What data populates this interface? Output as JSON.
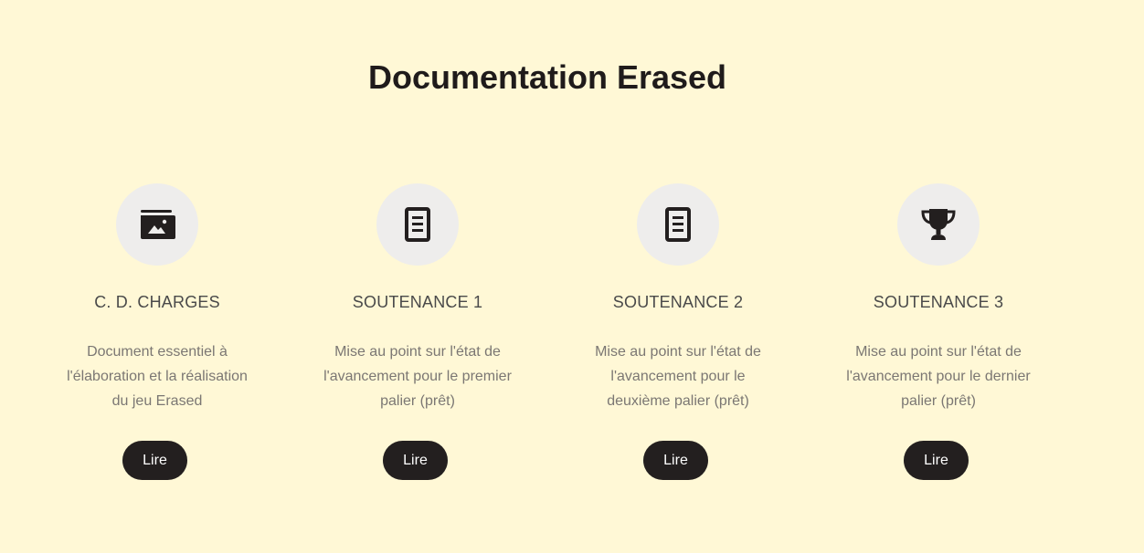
{
  "page": {
    "title": "Documentation Erased"
  },
  "cards": [
    {
      "icon": "photo-folder-icon",
      "title": "C. D. CHARGES",
      "description": "Document essentiel à l'élaboration et la réalisation du jeu Erased",
      "button_label": "Lire"
    },
    {
      "icon": "document-icon",
      "title": "SOUTENANCE 1",
      "description": "Mise au point sur l'état de l'avancement pour le premier palier (prêt)",
      "button_label": "Lire"
    },
    {
      "icon": "document-icon",
      "title": "SOUTENANCE 2",
      "description": "Mise au point sur l'état de l'avancement pour le deuxième palier (prêt)",
      "button_label": "Lire"
    },
    {
      "icon": "trophy-icon",
      "title": "SOUTENANCE 3",
      "description": "Mise au point sur l'état de l'avancement pour le dernier palier (prêt)",
      "button_label": "Lire"
    }
  ],
  "colors": {
    "background": "#fff8d6",
    "button": "#231f1f",
    "icon_circle": "#eeedec",
    "icon": "#231f1f"
  }
}
